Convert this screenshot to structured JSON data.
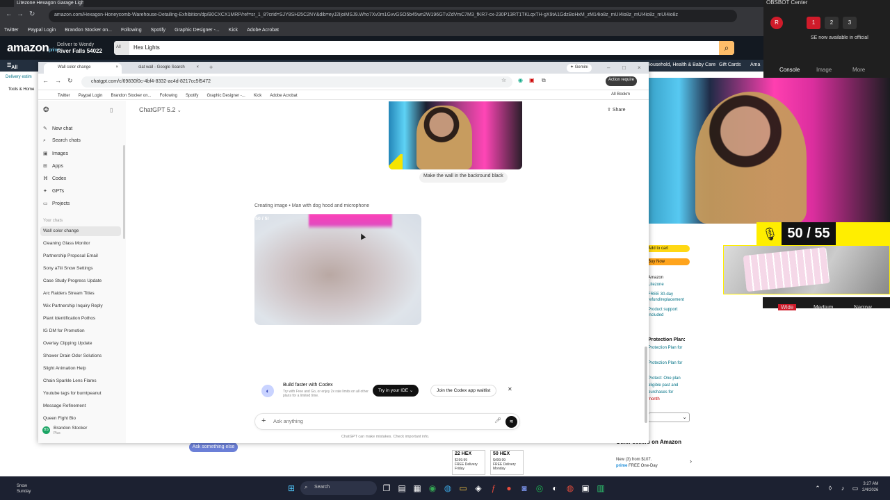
{
  "back_browser": {
    "tab_title": "Litezone Hexagon Garage Light",
    "url": "amazon.com/Hexagon-Honeycomb-Warehouse-Detailing-Exhibition/dp/B0CXCX1MRP/ref=sr_1_8?crid=SJY8SH25C2NY&dib=eyJ2IjoiMSJ9.Who7Xv0m1GvvGSO5b45wn2W196GTvZdVmC7M3_fKR7-cx-230P13RT1TKLqxTH-gX9tA1GdzBoHxM_zM14io8z_mUI4io8z_mUI4io8z_mUI4io8z",
    "bookmarks": [
      "Twitter",
      "Paypal Login",
      "Brandon Stocker on...",
      "Following",
      "Spotify",
      "Graphic Designer -...",
      "Kick",
      "Adobe Acrobat"
    ]
  },
  "amazon": {
    "logo": "amazon",
    "logo_sub": "prime",
    "deliver_line1": "Deliver to Wendy",
    "deliver_line2": "River Falls 54022",
    "search_category": "All",
    "search_value": "Hex Lights",
    "nav_all": "All",
    "nav_delivery": "Delivery estim",
    "nav_tools": "Tools & Home",
    "nav_items": [
      "Household, Health & Baby Care",
      "Gift Cards",
      "Ama"
    ],
    "add_to_cart": "Add to cart",
    "buy_now": "Buy Now",
    "side_lines": [
      "Amazon",
      "Litezone",
      "FREE 30-day",
      "refund/replacement",
      "Product support",
      "included"
    ],
    "protection_title": "Protection Plan:",
    "protection_lines": [
      "Protection Plan for",
      "Protection Plan for",
      "Protect: One plan",
      "eligible past and",
      "purchases for",
      "month"
    ],
    "hex_cards": [
      {
        "title": "22 HEX",
        "price": "$199.99",
        "delivery": "FREE Delivery",
        "day": "Friday"
      },
      {
        "title": "50 HEX",
        "price": "$499.99",
        "delivery": "FREE Delivery",
        "day": "Monday"
      }
    ],
    "other_sellers": "Other sellers on Amazon",
    "other_new": "New (3) from $107.",
    "other_prime": "prime",
    "other_free": "FREE One-Day",
    "ask_else": "Ask something else"
  },
  "obs": {
    "title": "OBSBOT Center",
    "avatar": "R",
    "scenes": [
      "1",
      "2",
      "3"
    ],
    "notice": "SE now available in official",
    "tabs": [
      "Console",
      "Image",
      "More"
    ]
  },
  "overlay": {
    "counter": "50 / 55",
    "cam_buttons": [
      "Wide",
      "Medium",
      "Narrow"
    ]
  },
  "front_browser": {
    "tabs": [
      {
        "label": "Wall color change",
        "active": true
      },
      {
        "label": "slat wall - Google Search",
        "active": false
      }
    ],
    "url": "chatgpt.com/c/69830f0c-4bf4-8332-ac4d-8217cc5f5472",
    "bookmarks": [
      "Twitter",
      "Paypal Login",
      "Brandon Stocker on...",
      "Following",
      "Spotify",
      "Graphic Designer -...",
      "Kick",
      "Adobe Acrobat"
    ],
    "all_bookmarks": "All Bookm",
    "gemini": "Gemini",
    "action_required": "Action require"
  },
  "gpt": {
    "model": "ChatGPT 5.2",
    "share": "Share",
    "nav": [
      {
        "label": "New chat",
        "icon": "✎"
      },
      {
        "label": "Search chats",
        "icon": "⌕"
      },
      {
        "label": "Images",
        "icon": "▣"
      },
      {
        "label": "Apps",
        "icon": "⊞"
      },
      {
        "label": "Codex",
        "icon": "⌘"
      },
      {
        "label": "GPTs",
        "icon": "✦"
      },
      {
        "label": "Projects",
        "icon": "▭"
      }
    ],
    "your_chats": "Your chats",
    "chats": [
      "Wall color change",
      "Cleaning Glass Monitor",
      "Partnership Proposal Email",
      "Sony a7iii Snow Settings",
      "Case Study Progress Update",
      "Arc Raiders Stream Titles",
      "Wix Partnership Inquiry Reply",
      "Plant Identification Pothos",
      "IG DM for Promotion",
      "Overlay Clipping Update",
      "Shower Drain Odor Solutions",
      "Slight Animation Help",
      "Chain Sparkle Lens Flares",
      "Youtube tags for burntpeanut",
      "Message Refinement",
      "Queen Fight Bio"
    ],
    "user_name": "Brandon Stocker",
    "user_plan": "Plus",
    "user_initials": "BS",
    "user_message": "Make the wall in the backround black",
    "creating_label": "Creating image • Man with dog hood and microphone",
    "gen_progress": "50 / 5!",
    "promo_title": "Build faster with Codex",
    "promo_sub": "Try with Free and Go, or enjoy 2x rate limits on all other plans for a limited time.",
    "try_ide": "Try in your IDE",
    "join_waitlist": "Join the Codex app waitlist",
    "composer_placeholder": "Ask anything",
    "disclaimer": "ChatGPT can make mistakes. Check important info."
  },
  "taskbar": {
    "weather_line1": "Snow",
    "weather_line2": "Sunday",
    "search": "Search",
    "time": "3:27 AM",
    "date": "2/4/2026"
  },
  "colors": {
    "amazon_header": "#131921",
    "amazon_nav": "#232f3e",
    "search_button": "#febd69",
    "overlay_yellow": "#ffee00",
    "obs_red": "#d01b2a"
  }
}
